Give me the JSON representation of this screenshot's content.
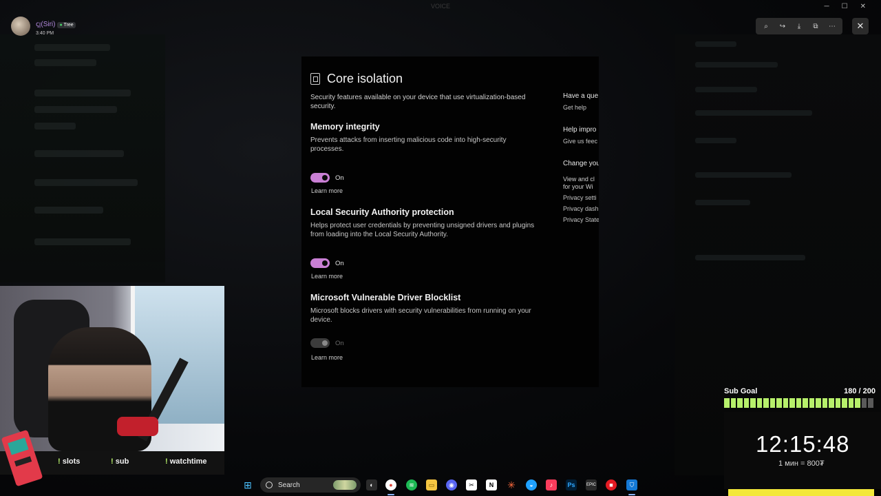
{
  "window": {
    "title": "VOICE"
  },
  "user": {
    "name": "ꞔꞁ(Siri)",
    "badge": "Tree",
    "time": "3:40 PM"
  },
  "viewer_tools": {
    "close_glyph": "✕"
  },
  "settings": {
    "title": "Core isolation",
    "description": "Security features available on your device that use virtualization-based security.",
    "sections": [
      {
        "title": "Memory integrity",
        "desc": "Prevents attacks from inserting malicious code into high-security processes.",
        "toggle": "On",
        "state": "on",
        "link": "Learn more"
      },
      {
        "title": "Local Security Authority protection",
        "desc": "Helps protect user credentials by preventing unsigned drivers and plugins from loading into the Local Security Authority.",
        "toggle": "On",
        "state": "on",
        "link": "Learn more"
      },
      {
        "title": "Microsoft Vulnerable Driver Blocklist",
        "desc": "Microsoft blocks drivers with security vulnerabilities from running on your device.",
        "toggle": "On",
        "state": "disabled",
        "link": "Learn more"
      }
    ],
    "aside": {
      "question": "Have a que",
      "get_help": "Get help",
      "improve": "Help impro",
      "feedback": "Give us feec",
      "change": "Change you",
      "view": "View and cl",
      "view2": "for your Wi",
      "privacy_settings": "Privacy setti",
      "privacy_dash": "Privacy dash",
      "privacy_state": "Privacy State"
    }
  },
  "commands": [
    "slots",
    "sub",
    "watchtime"
  ],
  "sub_goal": {
    "label": "Sub Goal",
    "current": 180,
    "target": 200,
    "progress_text": "180 / 200"
  },
  "timer": {
    "value": "12:15:48",
    "rate": "1 мин = 800₮"
  },
  "taskbar": {
    "search_placeholder": "Search"
  },
  "colors": {
    "toggle_on": "#c97fd4",
    "goal_bar": "#b7f06b",
    "yellow": "#f3e83a"
  }
}
